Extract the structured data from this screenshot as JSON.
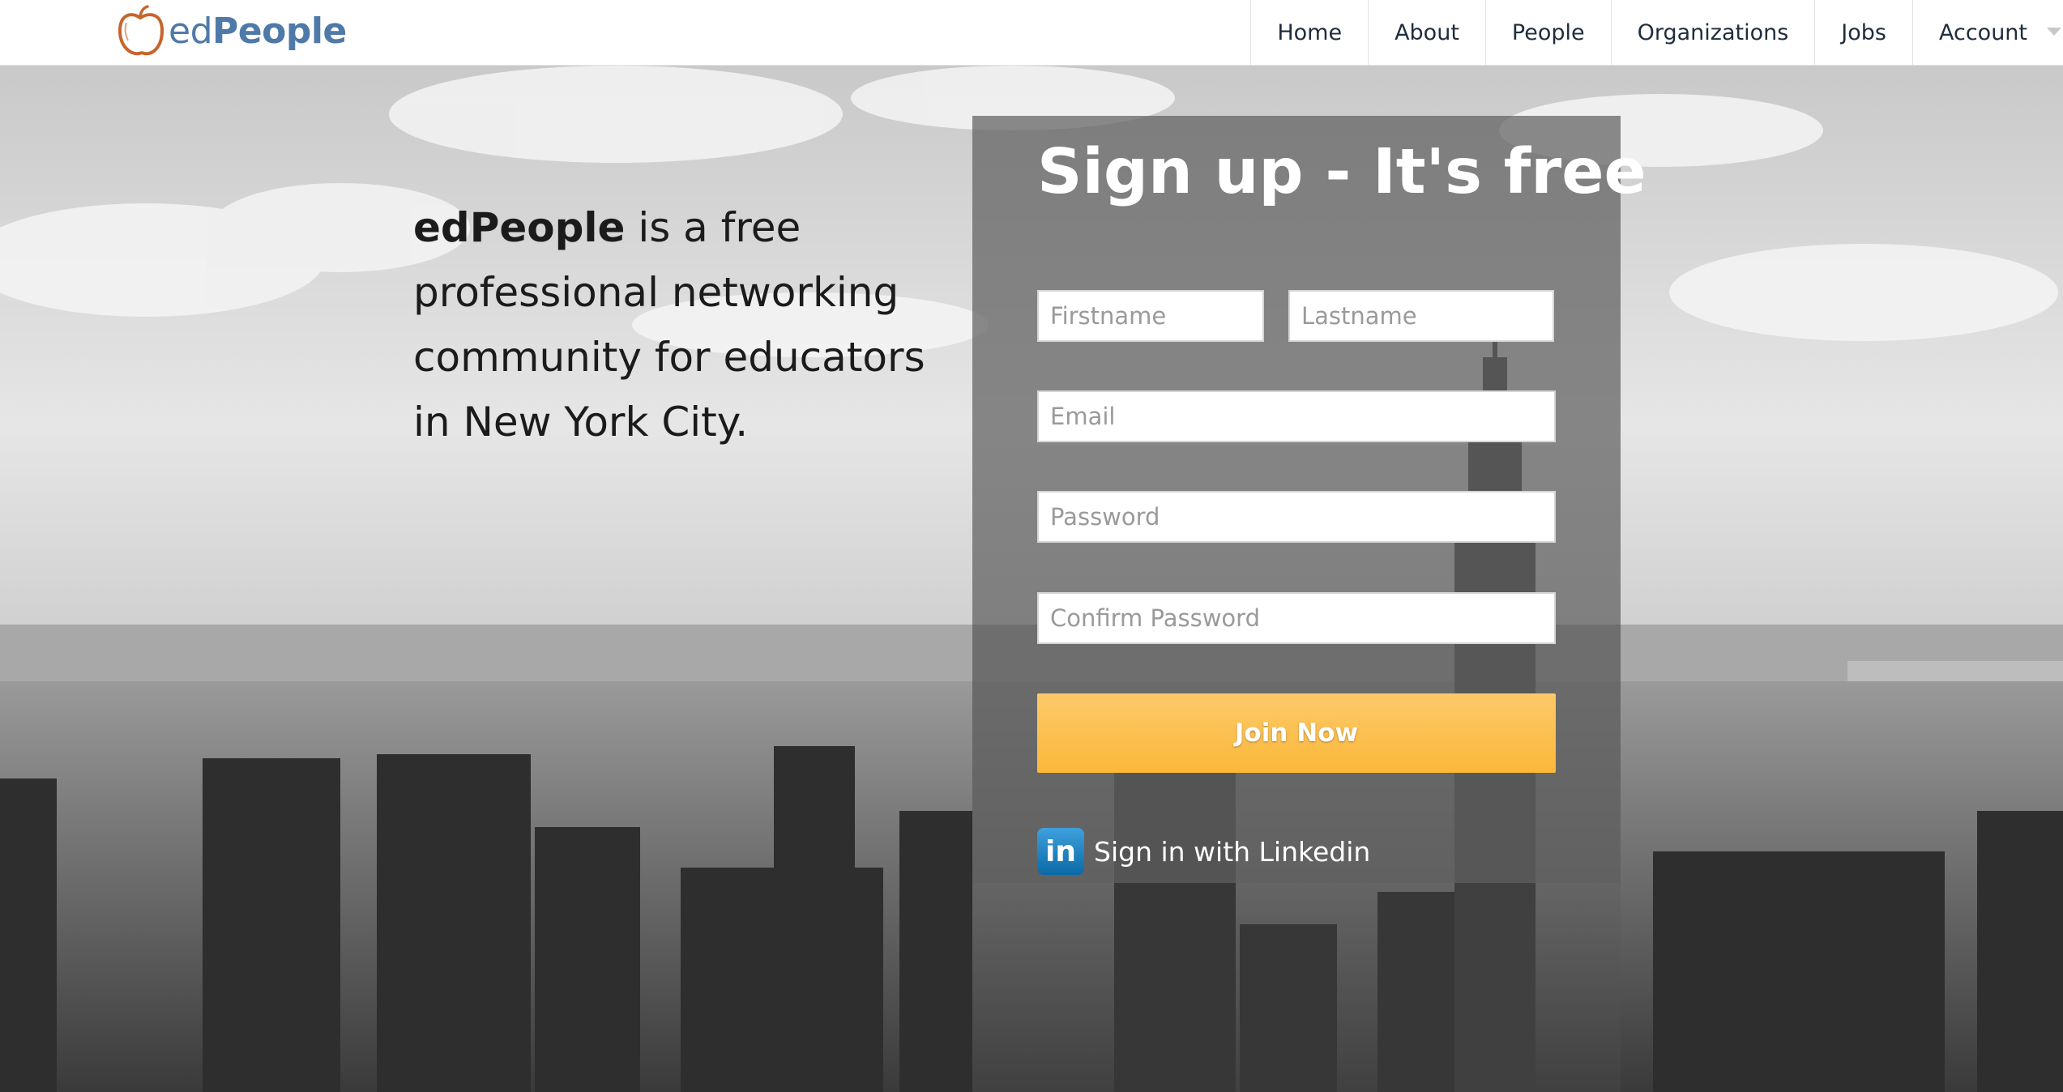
{
  "brand": {
    "part1": "ed",
    "part2": "People",
    "icon": "apple-icon"
  },
  "nav": {
    "items": [
      {
        "label": "Home"
      },
      {
        "label": "About"
      },
      {
        "label": "People"
      },
      {
        "label": "Organizations"
      },
      {
        "label": "Jobs"
      },
      {
        "label": "Account"
      }
    ],
    "account_icon": "chevron-down-icon"
  },
  "hero": {
    "tagline_brand": "edPeople",
    "tagline_rest": " is a free professional networking community for educators in New York City."
  },
  "signup": {
    "title": "Sign up - It's free",
    "firstname_placeholder": "Firstname",
    "lastname_placeholder": "Lastname",
    "email_placeholder": "Email",
    "password_placeholder": "Password",
    "confirm_password_placeholder": "Confirm Password",
    "join_label": "Join Now",
    "linkedin_icon_text": "in",
    "linkedin_label": "Sign in with Linkedin"
  },
  "colors": {
    "brand_blue": "#4f79a8",
    "apple_orange": "#c8642c",
    "join_button": "#fbbf4a",
    "linkedin_blue": "#0a6aa8",
    "panel_overlay": "#5f5f5f"
  }
}
